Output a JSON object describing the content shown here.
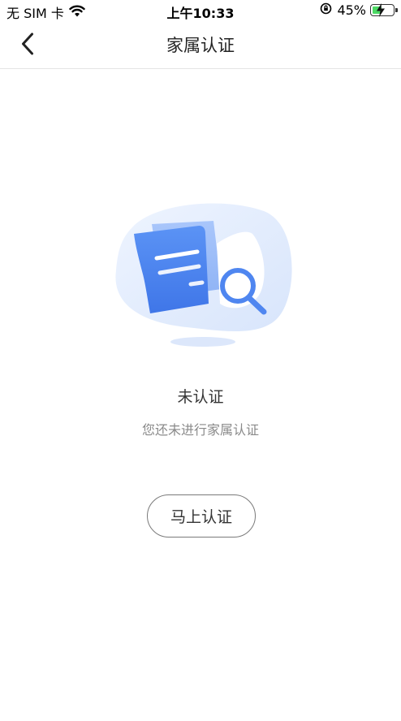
{
  "status_bar": {
    "carrier": "无 SIM 卡",
    "time": "上午10:33",
    "battery_percent": "45%",
    "icons": [
      "wifi-icon",
      "orientation-lock-icon",
      "battery-charging-icon"
    ]
  },
  "nav": {
    "title": "家属认证",
    "back_icon": "chevron-left-icon"
  },
  "empty_state": {
    "title": "未认证",
    "subtitle": "您还未进行家属认证",
    "illustration": "document-search-icon"
  },
  "action": {
    "button_label": "马上认证"
  },
  "colors": {
    "accent_blue": "#4f86f0",
    "blob": "#e6efff",
    "button_border": "#7a7a7a",
    "divider": "#e5e5e5"
  }
}
